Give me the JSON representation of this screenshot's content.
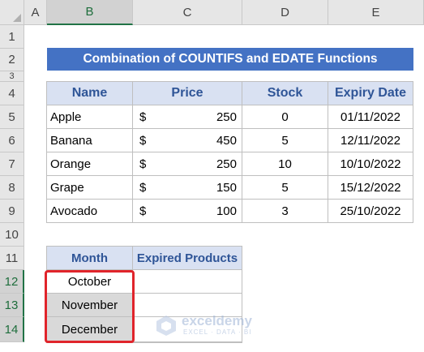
{
  "columns": [
    "A",
    "B",
    "C",
    "D",
    "E"
  ],
  "rows": [
    "1",
    "2",
    "3",
    "4",
    "5",
    "6",
    "7",
    "8",
    "9",
    "10",
    "11",
    "12",
    "13",
    "14"
  ],
  "title": "Combination of COUNTIFS and EDATE Functions",
  "table": {
    "headers": [
      "Name",
      "Price",
      "Stock",
      "Expiry Date"
    ],
    "rows": [
      {
        "name": "Apple",
        "currency": "$",
        "price": "250",
        "stock": "0",
        "expiry": "01/11/2022"
      },
      {
        "name": "Banana",
        "currency": "$",
        "price": "450",
        "stock": "5",
        "expiry": "12/11/2022"
      },
      {
        "name": "Orange",
        "currency": "$",
        "price": "250",
        "stock": "10",
        "expiry": "10/10/2022"
      },
      {
        "name": "Grape",
        "currency": "$",
        "price": "150",
        "stock": "5",
        "expiry": "15/12/2022"
      },
      {
        "name": "Avocado",
        "currency": "$",
        "price": "100",
        "stock": "3",
        "expiry": "25/10/2022"
      }
    ]
  },
  "month_table": {
    "headers": [
      "Month",
      "Expired Products"
    ],
    "rows": [
      {
        "month": "October",
        "expired": ""
      },
      {
        "month": "November",
        "expired": ""
      },
      {
        "month": "December",
        "expired": ""
      }
    ]
  },
  "watermark": {
    "name": "exceldemy",
    "tagline": "EXCEL · DATA · BI"
  },
  "colors": {
    "title_bg": "#4472c4",
    "header_bg": "#d9e1f2",
    "header_text": "#2f5597",
    "highlight": "#e0242b",
    "selection": "#217346"
  }
}
